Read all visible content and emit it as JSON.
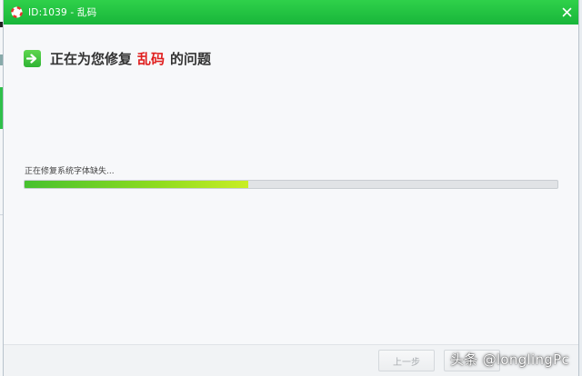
{
  "window": {
    "title": "ID:1039 - 乱码",
    "title_bar_color": "#1fbf3d"
  },
  "heading": {
    "prefix": "正在为您修复",
    "highlight": "乱码",
    "suffix": "的问题",
    "highlight_color": "#e01e1e"
  },
  "progress": {
    "status": "正在修复系统字体缺失...",
    "fraction": 0.42
  },
  "footer": {
    "prev_label": "上一步",
    "next_label": ""
  },
  "watermark": {
    "text": "头条 @longlingPc"
  },
  "icons": {
    "app": "lifebuoy-icon",
    "close": "close-icon",
    "heading": "arrow-right-icon"
  }
}
